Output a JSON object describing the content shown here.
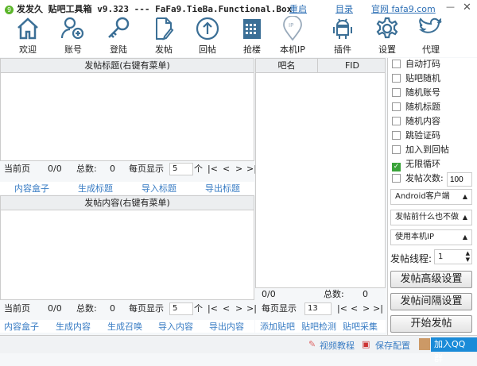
{
  "titlebar": {
    "logo": "9",
    "title": "发发久  贴吧工具箱 v9.323 --- FaFa9.TieBa.Functional.Box",
    "restart": "重启",
    "catalog": "目录",
    "website": "官网 fafa9.com",
    "minimize": "—",
    "close": "✕"
  },
  "toolbar": [
    {
      "label": "欢迎",
      "icon": "home-icon"
    },
    {
      "label": "账号",
      "icon": "add-user-icon"
    },
    {
      "label": "登陆",
      "icon": "key-icon"
    },
    {
      "label": "发帖",
      "icon": "document-icon"
    },
    {
      "label": "回帖",
      "icon": "upload-icon"
    },
    {
      "label": "抢楼",
      "icon": "calendar-icon"
    },
    {
      "label": "本机IP",
      "icon": "ip-pin-icon"
    },
    {
      "label": "插件",
      "icon": "android-icon"
    },
    {
      "label": "设置",
      "icon": "gear-icon"
    },
    {
      "label": "代理",
      "icon": "twitter-icon"
    }
  ],
  "title_panel": {
    "header": "发帖标题(右键有菜单)",
    "pager": {
      "current_label": "当前页",
      "current": "0/0",
      "total_label": "总数:",
      "total": "0",
      "per_page_label": "每页显示",
      "per_page": "5",
      "unit": "个",
      "first": "|<",
      "prev": "<",
      "next": ">",
      "last": ">|"
    },
    "links": [
      "内容盒子",
      "生成标题",
      "导入标题",
      "导出标题"
    ]
  },
  "content_panel": {
    "header": "发帖内容(右键有菜单)",
    "pager": {
      "current_label": "当前页",
      "current": "0/0",
      "total_label": "总数:",
      "total": "0",
      "per_page_label": "每页显示",
      "per_page": "5",
      "unit": "个",
      "first": "|<",
      "prev": "<",
      "next": ">",
      "last": ">|"
    },
    "links": [
      "内容盒子",
      "生成内容",
      "生成召唤",
      "导入内容",
      "导出内容"
    ]
  },
  "bar_panel": {
    "col_name": "吧名",
    "col_fid": "FID",
    "current": "0/0",
    "total_label": "总数:",
    "total": "0",
    "per_page_label": "每页显示",
    "per_page": "13",
    "first": "|<",
    "prev": "<",
    "next": ">",
    "last": ">|",
    "links": [
      "添加贴吧",
      "贴吧检测",
      "贴吧采集"
    ]
  },
  "options": {
    "checkboxes": [
      {
        "label": "自动打码",
        "checked": false
      },
      {
        "label": "贴吧随机",
        "checked": false
      },
      {
        "label": "随机账号",
        "checked": false
      },
      {
        "label": "随机标题",
        "checked": false
      },
      {
        "label": "随机内容",
        "checked": false
      },
      {
        "label": "跳验证码",
        "checked": false
      },
      {
        "label": "加入到回帖",
        "checked": false
      },
      {
        "label": "无限循环",
        "checked": true
      },
      {
        "label": "发帖次数:",
        "checked": false
      }
    ],
    "post_count": "100",
    "client": "Android客户端",
    "before_post": "发帖前什么也不做",
    "ip_mode": "使用本机IP",
    "threads_label": "发帖线程:",
    "threads": "1",
    "advanced": "发帖高级设置",
    "interval": "发帖间隔设置",
    "start": "开始发帖"
  },
  "statusbar": {
    "video": "视频教程",
    "save": "保存配置",
    "qq": "加入QQ群"
  }
}
